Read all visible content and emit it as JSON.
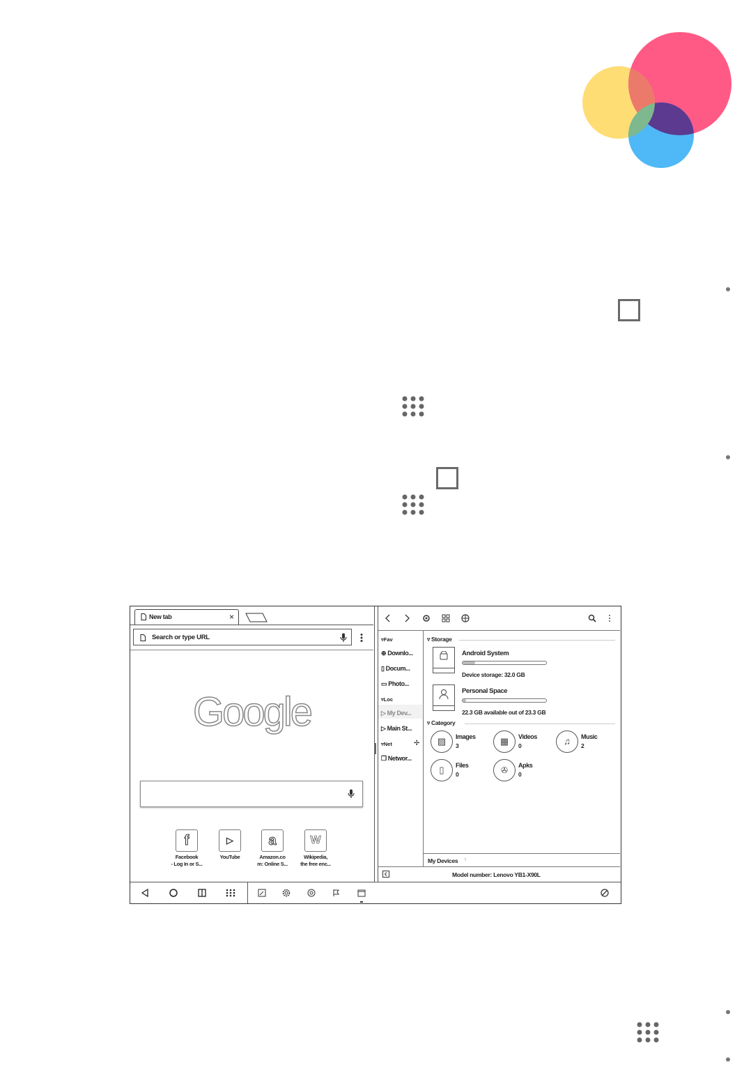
{
  "decor": {
    "colors": {
      "pink": "#ff5a85",
      "yellow": "#ffdd75",
      "blue": "#4fb8f6",
      "overlap": "#5b3a8f"
    }
  },
  "page_icons": [
    "square-icon",
    "apps-grid-icon",
    "square-icon",
    "apps-grid-icon",
    "apps-grid-icon"
  ],
  "browser": {
    "tab_label": "New tab",
    "tab_close": "×",
    "url_placeholder": "Search or type URL",
    "logo_text": "Google",
    "tiles": [
      {
        "glyph": "f",
        "caption_1": "Facebook",
        "caption_2": "- Log In or S..."
      },
      {
        "glyph": "▷",
        "caption_1": "YouTube",
        "caption_2": ""
      },
      {
        "glyph": "a",
        "caption_1": "Amazon.co",
        "caption_2": "m: Online S..."
      },
      {
        "glyph": "W",
        "caption_1": "Wikipedia,",
        "caption_2": "the free enc..."
      }
    ]
  },
  "file_manager": {
    "sidebar": {
      "fav": "Fav",
      "downloads": "Downlo...",
      "documents": "Docum...",
      "photos": "Photo...",
      "loc": "Loc",
      "my_devices": "My Dev...",
      "main_storage": "Main St...",
      "net": "Net",
      "network": "Networ..."
    },
    "storage_header": "Storage",
    "devices": [
      {
        "name": "Android System",
        "info": "Device storage: 32.0 GB",
        "fill": 0.15
      },
      {
        "name": "Personal Space",
        "info": "22.3 GB available out of 23.3 GB",
        "fill": 0.04
      }
    ],
    "category_header": "Category",
    "categories": [
      {
        "name": "Images",
        "count": "3",
        "icon": "image-icon"
      },
      {
        "name": "Videos",
        "count": "0",
        "icon": "film-icon"
      },
      {
        "name": "Music",
        "count": "2",
        "icon": "music-note-icon"
      },
      {
        "name": "Files",
        "count": "0",
        "icon": "file-icon"
      },
      {
        "name": "Apks",
        "count": "0",
        "icon": "android-icon"
      }
    ],
    "breadcrumb": "My Devices",
    "model_number": "Model number: Lenovo YB1-X90L"
  }
}
